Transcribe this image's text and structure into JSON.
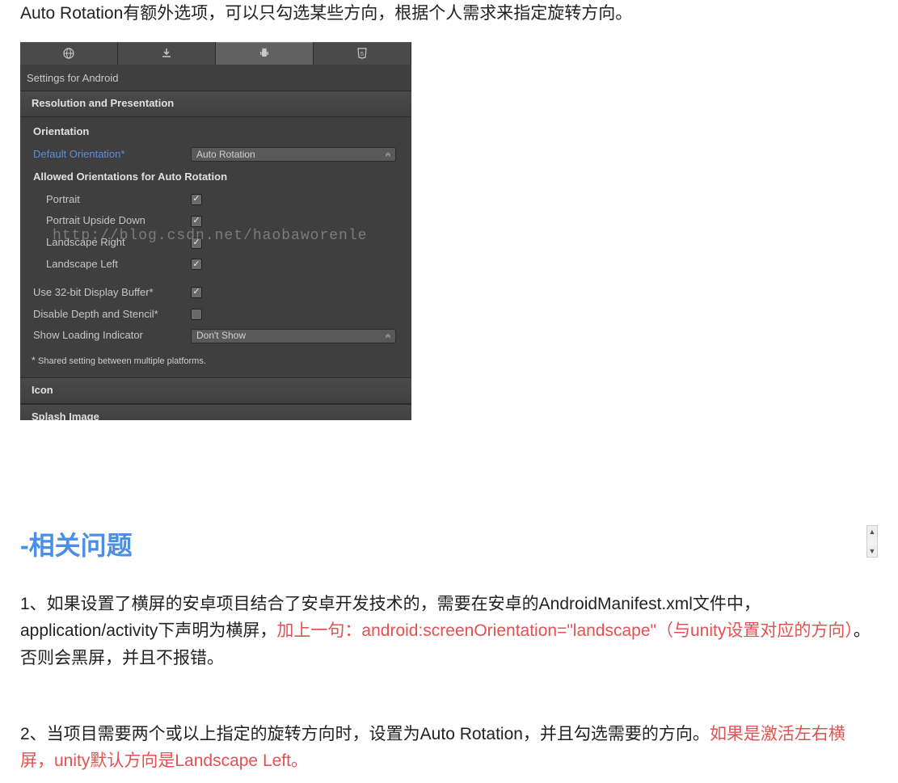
{
  "intro": "Auto Rotation有额外选项，可以只勾选某些方向，根据个人需求来指定旋转方向。",
  "panel": {
    "settings_title": "Settings for Android",
    "sections": {
      "resolution": "Resolution and Presentation",
      "orientation": "Orientation",
      "allowed": "Allowed Orientations for Auto Rotation",
      "icon": "Icon",
      "splash": "Splash Image"
    },
    "fields": {
      "default_orientation_label": "Default Orientation*",
      "default_orientation_value": "Auto Rotation",
      "portrait": "Portrait",
      "portrait_upside": "Portrait Upside Down",
      "landscape_right": "Landscape Right",
      "landscape_left": "Landscape Left",
      "use_32bit": "Use 32-bit Display Buffer*",
      "disable_depth": "Disable Depth and Stencil*",
      "show_loading_label": "Show Loading Indicator",
      "show_loading_value": "Don't Show"
    },
    "checks": {
      "portrait": "✓",
      "portrait_upside": "✓",
      "landscape_right": "✓",
      "landscape_left": "✓",
      "use_32bit": "✓",
      "disable_depth": ""
    },
    "footnote_prefix": "* ",
    "footnote": "Shared setting between multiple platforms.",
    "watermark": "http://blog.csdn.net/haobaworenle"
  },
  "related": {
    "heading": "-相关问题",
    "p1a": "1、如果设置了横屏的安卓项目结合了安卓开发技术的，需要在安卓的AndroidManifest.xml文件中，application/activity下声明为横屏，",
    "p1b": "加上一句：android:screenOrientation=\"landscape\"（与unity设置对应的方向）",
    "p1c": "。否则会黑屏，并且不报错。",
    "p2a": "2、当项目需要两个或以上指定的旋转方向时，设置为Auto Rotation，并且勾选需要的方向。",
    "p2b": "如果是激活左右横屏，unity默认方向是Landscape Left。"
  },
  "scrollbar": {
    "up": "▲",
    "down": "▼"
  }
}
